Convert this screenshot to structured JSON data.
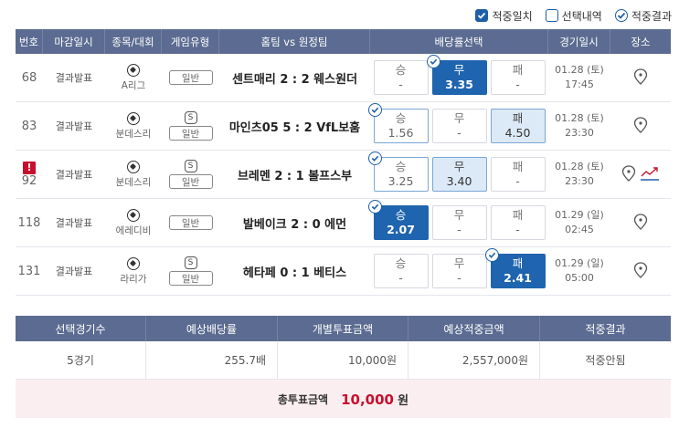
{
  "legend": {
    "items": [
      {
        "label": "적중일치",
        "style": "filled"
      },
      {
        "label": "선택내역",
        "style": "empty"
      },
      {
        "label": "적중결과",
        "style": "check"
      }
    ]
  },
  "table": {
    "headers": [
      "번호",
      "마감일시",
      "종목/대회",
      "게임유형",
      "홈팀 vs 원정팀",
      "배당률선택",
      "경기일시",
      "장소"
    ],
    "rows": [
      {
        "no": "68",
        "alert": false,
        "close": "결과발표",
        "league": "A리그",
        "special": false,
        "type": "일반",
        "match": "센트매리 2 : 2 웨스원더",
        "odds": [
          {
            "label": "승",
            "value": "-",
            "state": "none"
          },
          {
            "label": "무",
            "value": "3.35",
            "state": "sel",
            "tick": true
          },
          {
            "label": "패",
            "value": "-",
            "state": "none"
          }
        ],
        "date": "01.28 (토)",
        "time": "17:45",
        "chart": false
      },
      {
        "no": "83",
        "alert": false,
        "close": "결과발표",
        "league": "분데스리",
        "special": true,
        "special_label": "S",
        "type": "일반",
        "match": "마인츠05 5 : 2 VfL보훔",
        "odds": [
          {
            "label": "승",
            "value": "1.56",
            "state": "ring",
            "tick": true
          },
          {
            "label": "무",
            "value": "-",
            "state": "none"
          },
          {
            "label": "패",
            "value": "4.50",
            "state": "pick"
          }
        ],
        "date": "01.28 (토)",
        "time": "23:30",
        "chart": false
      },
      {
        "no": "92",
        "alert": true,
        "alert_label": "!",
        "close": "결과발표",
        "league": "분데스리",
        "special": true,
        "special_label": "S",
        "type": "일반",
        "match": "브레멘 2 : 1 볼프스부",
        "odds": [
          {
            "label": "승",
            "value": "3.25",
            "state": "ring",
            "tick": true
          },
          {
            "label": "무",
            "value": "3.40",
            "state": "pick"
          },
          {
            "label": "패",
            "value": "-",
            "state": "none"
          }
        ],
        "date": "01.28 (토)",
        "time": "23:30",
        "chart": true
      },
      {
        "no": "118",
        "alert": false,
        "close": "결과발표",
        "league": "에레디비",
        "special": false,
        "type": "일반",
        "match": "발베이크 2 : 0 에먼",
        "odds": [
          {
            "label": "승",
            "value": "2.07",
            "state": "sel",
            "tick": true
          },
          {
            "label": "무",
            "value": "-",
            "state": "none"
          },
          {
            "label": "패",
            "value": "-",
            "state": "none"
          }
        ],
        "date": "01.29 (일)",
        "time": "02:45",
        "chart": false
      },
      {
        "no": "131",
        "alert": false,
        "close": "결과발표",
        "league": "라리가",
        "special": true,
        "special_label": "S",
        "type": "일반",
        "match": "헤타페 0 : 1 베티스",
        "odds": [
          {
            "label": "승",
            "value": "-",
            "state": "none"
          },
          {
            "label": "무",
            "value": "-",
            "state": "none"
          },
          {
            "label": "패",
            "value": "2.41",
            "state": "sel",
            "tick": true
          }
        ],
        "date": "01.29 (일)",
        "time": "05:00",
        "chart": false
      }
    ]
  },
  "summary": {
    "headers": [
      "선택경기수",
      "예상배당률",
      "개별투표금액",
      "예상적중금액",
      "적중결과"
    ],
    "values": [
      "5경기",
      "255.7배",
      "10,000원",
      "2,557,000원",
      "적중안됨"
    ],
    "total_label": "총투표금액",
    "total_amount": "10,000",
    "total_unit": "원"
  },
  "colors": {
    "header_bg": "#5b6b91",
    "selected": "#1f64ae",
    "picked": "#dce9f7",
    "alert": "#c8102e",
    "total_bg": "#fbeef0"
  }
}
